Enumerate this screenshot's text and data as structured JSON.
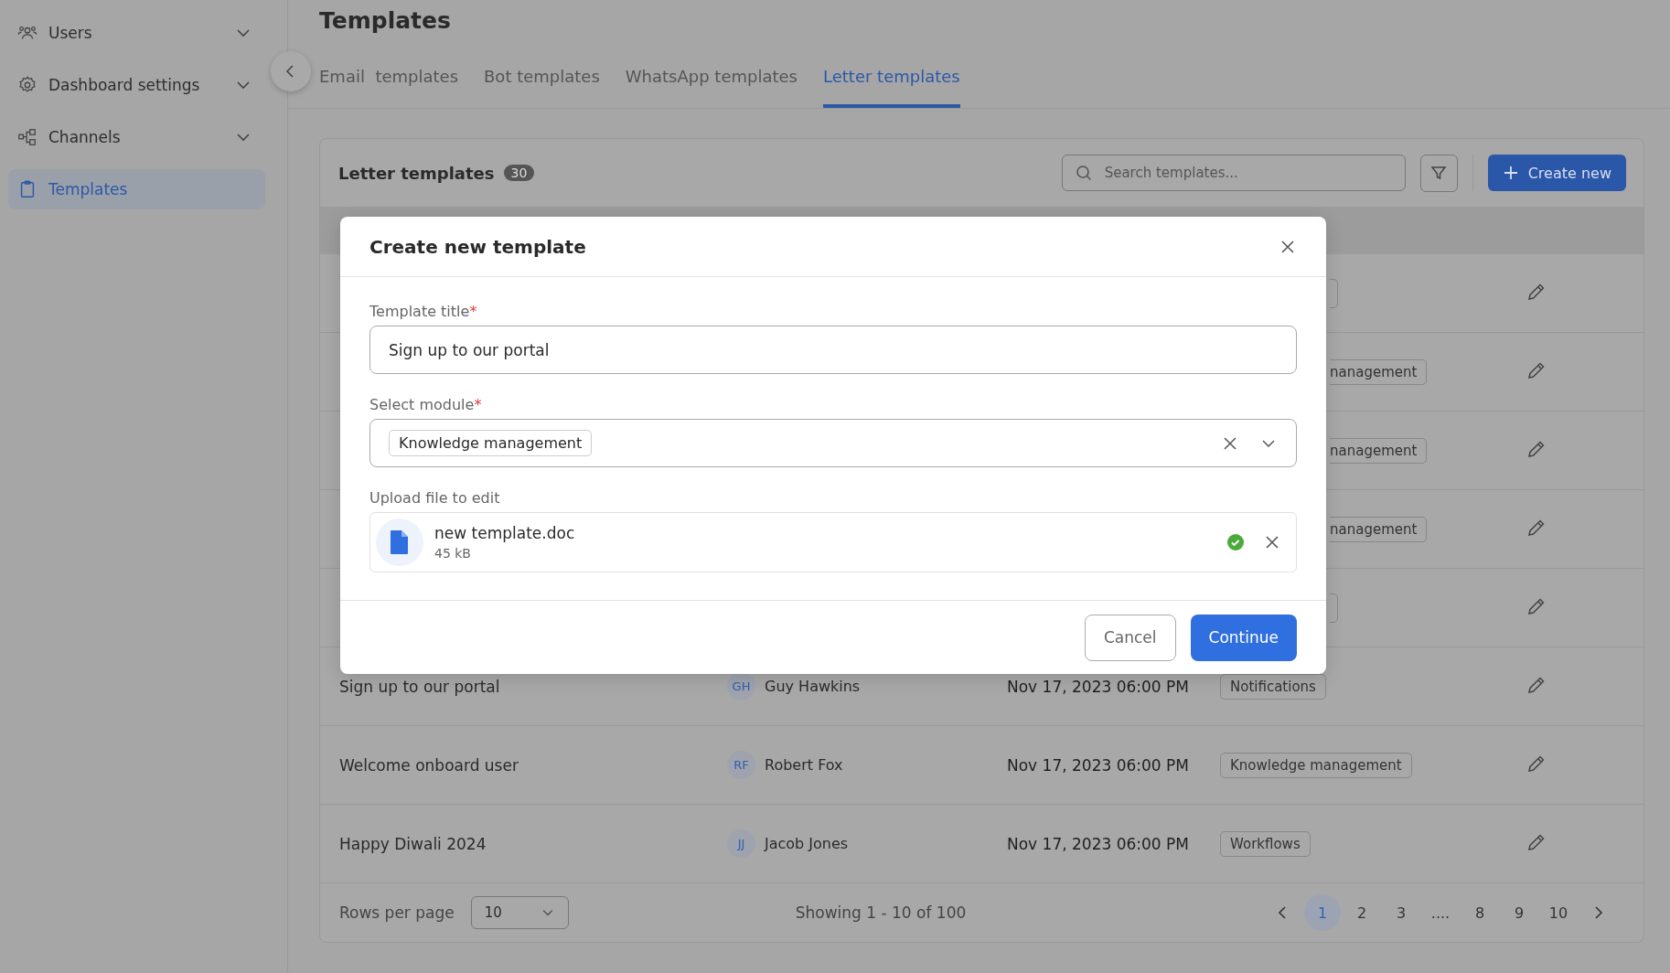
{
  "sidebar": {
    "items": [
      {
        "label": "Users",
        "expandable": true,
        "selected": false
      },
      {
        "label": "Dashboard settings",
        "expandable": true,
        "selected": false
      },
      {
        "label": "Channels",
        "expandable": true,
        "selected": false
      },
      {
        "label": "Templates",
        "expandable": false,
        "selected": true
      }
    ]
  },
  "page_title": "Templates",
  "tabs": [
    {
      "label": "Email  templates",
      "selected": false
    },
    {
      "label": "Bot templates",
      "selected": false
    },
    {
      "label": "WhatsApp templates",
      "selected": false
    },
    {
      "label": "Letter templates",
      "selected": true
    }
  ],
  "card": {
    "title": "Letter templates",
    "count": "30",
    "search": {
      "placeholder": "Search templates..."
    },
    "create_button": "Create new"
  },
  "table": {
    "rows": [
      {
        "kind": "covered"
      },
      {
        "kind": "covered",
        "tag": "nanagement"
      },
      {
        "kind": "covered",
        "tag": "nanagement"
      },
      {
        "kind": "covered",
        "tag": "nanagement"
      },
      {
        "kind": "covered"
      },
      {
        "kind": "full",
        "title": "Sign up to our portal",
        "initials": "GH",
        "author": "Guy Hawkins",
        "date": "Nov 17, 2023 06:00 PM",
        "tag": "Notifications"
      },
      {
        "kind": "full",
        "title": "Welcome onboard user",
        "initials": "RF",
        "author": "Robert Fox",
        "date": "Nov 17, 2023 06:00 PM",
        "tag": "Knowledge management"
      },
      {
        "kind": "full",
        "title": "Happy Diwali 2024",
        "initials": "JJ",
        "author": "Jacob Jones",
        "date": "Nov 17, 2023 06:00 PM",
        "tag": "Workflows"
      }
    ]
  },
  "pagination": {
    "rows_per_page_label": "Rows per page",
    "rows_per_page": "10",
    "summary": "Showing 1 - 10 of 100",
    "pages": [
      {
        "label": "1",
        "selected": true
      },
      {
        "label": "2",
        "selected": false
      },
      {
        "label": "3",
        "selected": false
      },
      {
        "label": "....",
        "selected": false
      },
      {
        "label": "8",
        "selected": false
      },
      {
        "label": "9",
        "selected": false
      },
      {
        "label": "10",
        "selected": false
      }
    ]
  },
  "modal": {
    "title": "Create new template",
    "title_field": {
      "label": "Template title",
      "required_mark": "*",
      "value": "Sign up to our portal"
    },
    "module_field": {
      "label": "Select module",
      "required_mark": "*",
      "chip": "Knowledge management"
    },
    "upload": {
      "label": "Upload file to edit",
      "file_name": "new template.doc",
      "size": "45 kB",
      "uploaded": true
    },
    "cancel_button": "Cancel",
    "continue_button": "Continue"
  }
}
